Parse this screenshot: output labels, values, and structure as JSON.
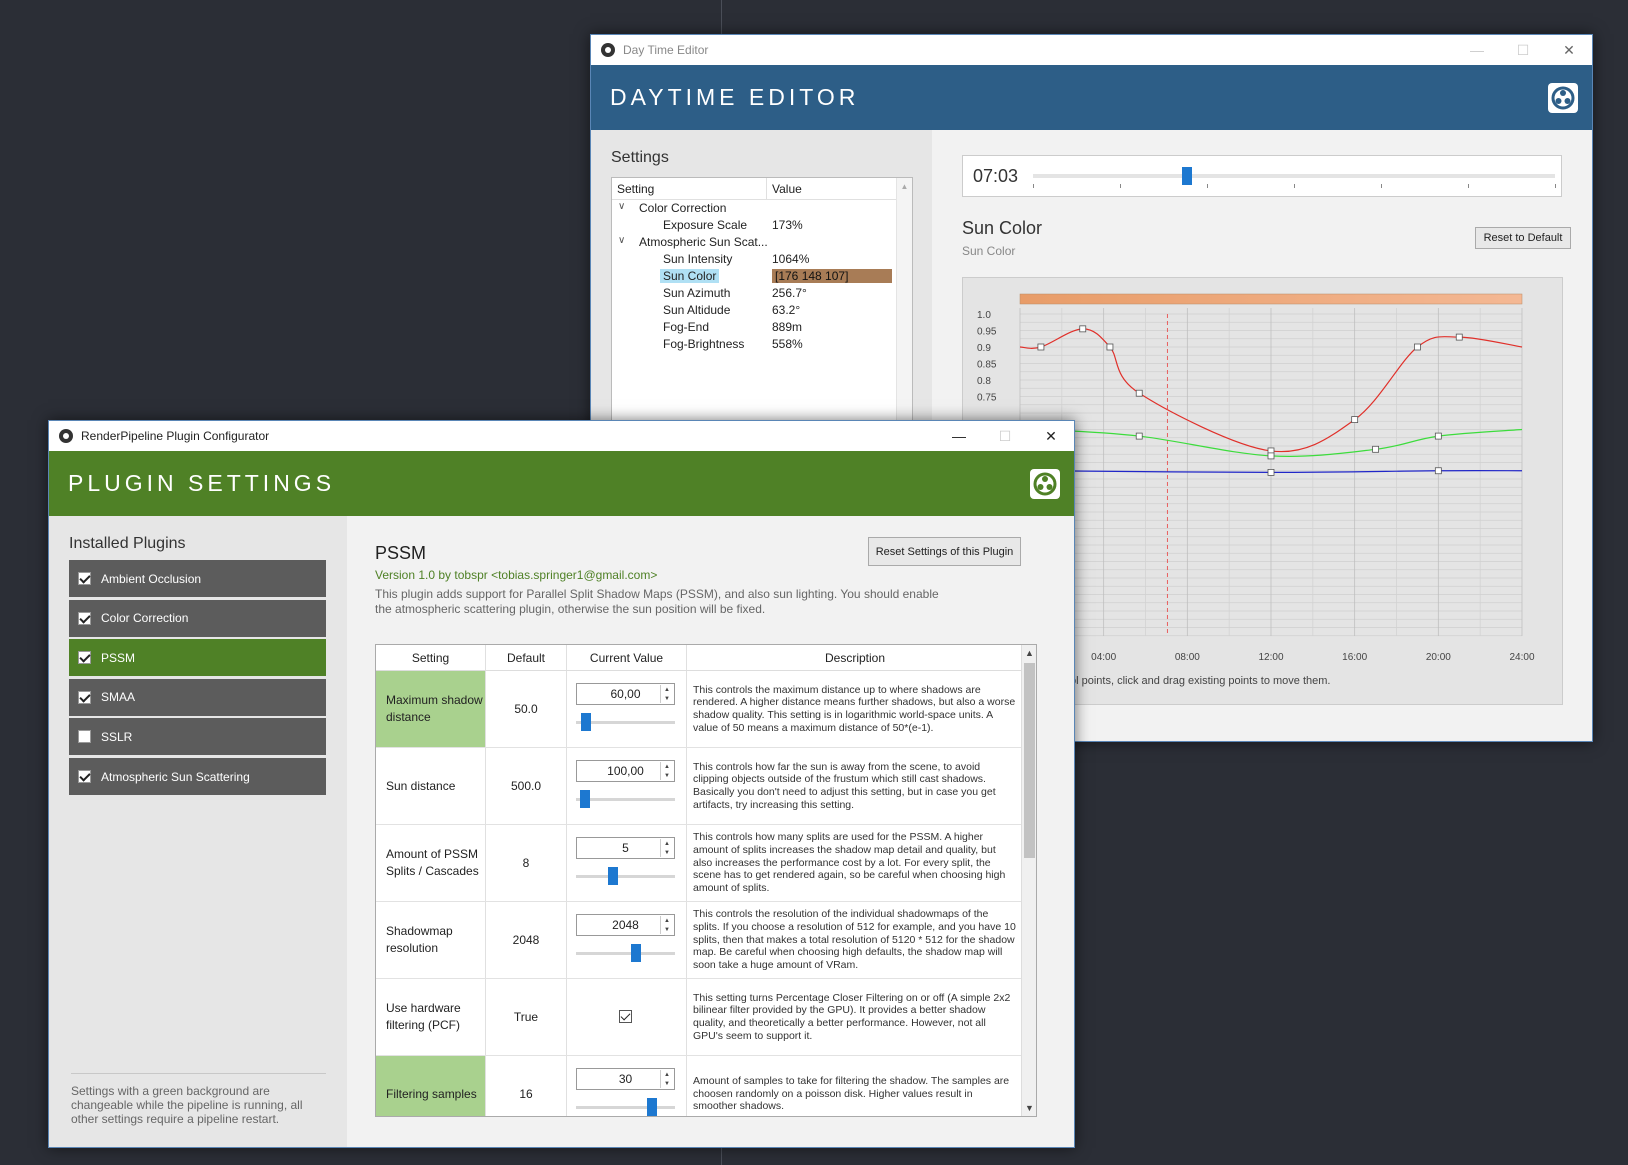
{
  "daytime_editor": {
    "window_title": "Day Time Editor",
    "banner_title": "DAYTIME EDITOR",
    "settings_heading": "Settings",
    "tree": {
      "columns": [
        "Setting",
        "Value"
      ],
      "rows": [
        {
          "name": "Color Correction",
          "value": "",
          "level": 0,
          "expanded": true
        },
        {
          "name": "Exposure Scale",
          "value": "173%",
          "level": 1
        },
        {
          "name": "Atmospheric Sun Scat...",
          "value": "",
          "level": 0,
          "expanded": true
        },
        {
          "name": "Sun Intensity",
          "value": "1064%",
          "level": 1
        },
        {
          "name": "Sun Color",
          "value": "[176 148 107]",
          "level": 1,
          "selected": true
        },
        {
          "name": "Sun Azimuth",
          "value": "256.7°",
          "level": 1
        },
        {
          "name": "Sun Altidude",
          "value": "63.2°",
          "level": 1
        },
        {
          "name": "Fog-End",
          "value": "889m",
          "level": 1
        },
        {
          "name": "Fog-Brightness",
          "value": "558%",
          "level": 1
        }
      ]
    },
    "time": {
      "label": "07:03",
      "fraction": 0.295
    },
    "curve_title": "Sun Color",
    "curve_subtitle": "Sun Color",
    "reset_button": "Reset to Default",
    "hint": "ve to add new control points, click and drag existing points to move them.",
    "curve_chart": {
      "y_ticks": [
        "1.0",
        "0.95",
        "0.9",
        "0.85",
        "0.8",
        "0.75"
      ],
      "x_ticks": [
        "04:00",
        "08:00",
        "12:00",
        "16:00",
        "20:00",
        "24:00"
      ],
      "current_time": 7.05,
      "colors": {
        "red": "#e0302a",
        "green": "#3cdc3c",
        "blue": "#2026c8",
        "marker": "#e86060",
        "gradient_start": "#e89c68",
        "gradient_end": "#f4b894"
      },
      "series": [
        {
          "name": "red",
          "points": [
            [
              1.0,
              0.9
            ],
            [
              3.0,
              0.955
            ],
            [
              4.3,
              0.9
            ],
            [
              5.7,
              0.76
            ],
            [
              12.0,
              0.585
            ],
            [
              16.0,
              0.68
            ],
            [
              19.0,
              0.9
            ],
            [
              21.0,
              0.93
            ],
            [
              24.0,
              0.9
            ]
          ]
        },
        {
          "name": "green",
          "points": [
            [
              1.0,
              0.65
            ],
            [
              5.7,
              0.63
            ],
            [
              12.0,
              0.57
            ],
            [
              17.0,
              0.59
            ],
            [
              20.0,
              0.63
            ],
            [
              24.0,
              0.65
            ]
          ]
        },
        {
          "name": "blue",
          "points": [
            [
              1.0,
              0.525
            ],
            [
              12.0,
              0.52
            ],
            [
              20.0,
              0.525
            ],
            [
              24.0,
              0.525
            ]
          ]
        }
      ]
    }
  },
  "plugin_configurator": {
    "window_title": "RenderPipeline Plugin Configurator",
    "banner_title": "PLUGIN SETTINGS",
    "installed_heading": "Installed Plugins",
    "plugins": [
      {
        "label": "Ambient Occlusion",
        "checked": true,
        "active": false
      },
      {
        "label": "Color Correction",
        "checked": true,
        "active": false
      },
      {
        "label": "PSSM",
        "checked": true,
        "active": true
      },
      {
        "label": "SMAA",
        "checked": true,
        "active": false
      },
      {
        "label": "SSLR",
        "checked": false,
        "active": false
      },
      {
        "label": "Atmospheric Sun Scattering",
        "checked": true,
        "active": false
      }
    ],
    "footer_note": "Settings with a green background are changeable while the pipeline is running, all other settings require a pipeline restart.",
    "plugin": {
      "name": "PSSM",
      "version": "Version 1.0 by tobspr <tobias.springer1@gmail.com>",
      "description": "This plugin adds support for Parallel Split Shadow Maps (PSSM), and also sun lighting. You should enable the atmospheric scattering plugin, otherwise the sun position will be fixed.",
      "reset_button": "Reset Settings of this Plugin"
    },
    "table": {
      "headers": [
        "Setting",
        "Default",
        "Current Value",
        "Description"
      ],
      "rows": [
        {
          "setting": "Maximum shadow distance",
          "default": "50.0",
          "value": "60,00",
          "slider": 0.06,
          "runtime": true,
          "desc": "This controls the maximum distance up to where shadows are rendered. A higher distance means further shadows, but also a worse shadow quality. This setting is in logarithmic world-space units. A value of 50 means a maximum distance of 50*(e-1)."
        },
        {
          "setting": "Sun distance",
          "default": "500.0",
          "value": "100,00",
          "slider": 0.04,
          "runtime": false,
          "desc": "This controls how far the sun is away from the scene, to avoid clipping objects outside of the frustum which still cast shadows. Basically you don't need to adjust this setting, but in case you get artifacts, try increasing this setting."
        },
        {
          "setting": "Amount of PSSM Splits / Cascades",
          "default": "8",
          "value": "5",
          "slider": 0.36,
          "runtime": false,
          "desc": "This controls how many splits are used for the PSSM. A higher amount of splits increases the shadow map detail and quality, but also increases the performance cost by a lot. For every split, the scene has to get rendered again, so be careful when choosing high amount of splits."
        },
        {
          "setting": "Shadowmap resolution",
          "default": "2048",
          "value": "2048",
          "slider": 0.62,
          "runtime": false,
          "desc": "This controls the resolution of the individual shadowmaps of the splits. If you choose a resolution of 512 for example, and you have 10 splits, then that makes a total resolution of 5120 * 512 for the shadow map. Be careful when choosing high defaults, the shadow map will soon take a huge amount of VRam."
        },
        {
          "setting": "Use hardware filtering (PCF)",
          "default": "True",
          "value": "",
          "checkbox": true,
          "runtime": false,
          "desc": "This setting turns Percentage Closer Filtering on or off (A simple 2x2 bilinear filter provided by the GPU). It provides a better shadow quality, and theoretically a better  performance. However, not all GPU's seem to support it."
        },
        {
          "setting": "Filtering samples",
          "default": "16",
          "value": "30",
          "slider": 0.8,
          "runtime": true,
          "desc": "Amount of samples to take for filtering the shadow. The samples are choosen randomly on a poisson disk. Higher values result in smoother shadows."
        }
      ]
    }
  }
}
